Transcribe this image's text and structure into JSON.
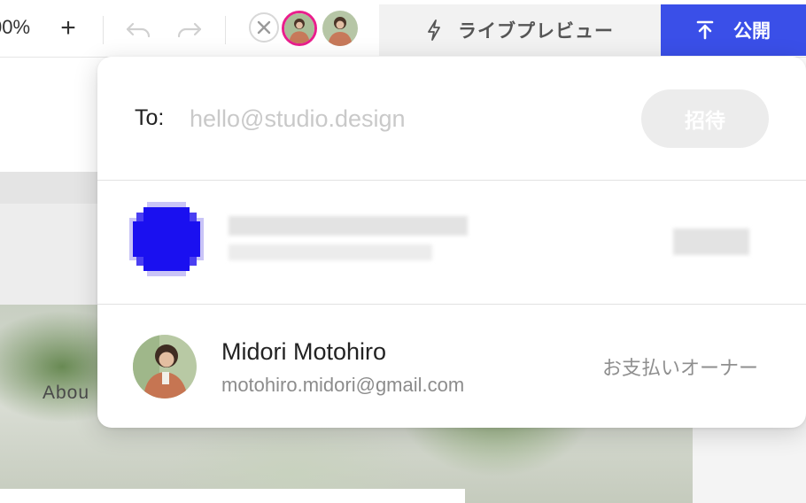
{
  "toolbar": {
    "zoom_label": "00%",
    "zoom_in_symbol": "+",
    "undo_icon": "undo-icon",
    "redo_icon": "redo-icon",
    "close_icon": "close-icon",
    "collaborators": [
      {
        "name": "collaborator-avatar-1",
        "active": true
      },
      {
        "name": "collaborator-avatar-2",
        "active": false
      }
    ],
    "live_preview_label": "ライブプレビュー",
    "live_preview_icon": "bolt-icon",
    "publish_label": "公開",
    "publish_icon": "upload-icon",
    "publish_color": "#3a4fe8",
    "active_ring_color": "#e91e8c"
  },
  "invite": {
    "to_label": "To:",
    "email_placeholder": "hello@studio.design",
    "email_value": "",
    "invite_button_label": "招待"
  },
  "members": [
    {
      "name": "",
      "email": "",
      "role": "",
      "obscured": true,
      "avatar_color": "#1a10f0"
    },
    {
      "name": "Midori Motohiro",
      "email": "motohiro.midori@gmail.com",
      "role": "お支払いオーナー",
      "obscured": false
    }
  ],
  "canvas": {
    "nav_link": "Abou"
  }
}
